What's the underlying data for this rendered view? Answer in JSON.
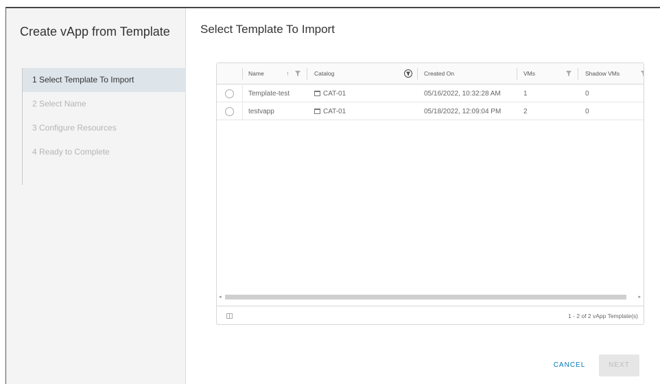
{
  "wizard": {
    "title": "Create vApp from Template",
    "steps": [
      {
        "label": "1  Select Template To Import",
        "active": true
      },
      {
        "label": "2  Select Name",
        "active": false
      },
      {
        "label": "3  Configure Resources",
        "active": false
      },
      {
        "label": "4  Ready to Complete",
        "active": false
      }
    ]
  },
  "main": {
    "title": "Select Template To Import"
  },
  "grid": {
    "columns": [
      "Name",
      "Catalog",
      "Created On",
      "VMs",
      "Shadow VMs"
    ],
    "rows": [
      {
        "name": "Template-test",
        "catalog": "CAT-01",
        "created_on": "05/16/2022, 10:32:28 AM",
        "vms": "1",
        "shadow_vms": "0"
      },
      {
        "name": "testvapp",
        "catalog": "CAT-01",
        "created_on": "05/18/2022, 12:09:04 PM",
        "vms": "2",
        "shadow_vms": "0"
      }
    ],
    "footer": "1 - 2 of 2 vApp Template(s)"
  },
  "buttons": {
    "cancel": "CANCEL",
    "next": "NEXT"
  },
  "colors": {
    "accent": "#0079b8",
    "active_step_bg": "#dde4ea",
    "filter_active": "#0079b8"
  }
}
